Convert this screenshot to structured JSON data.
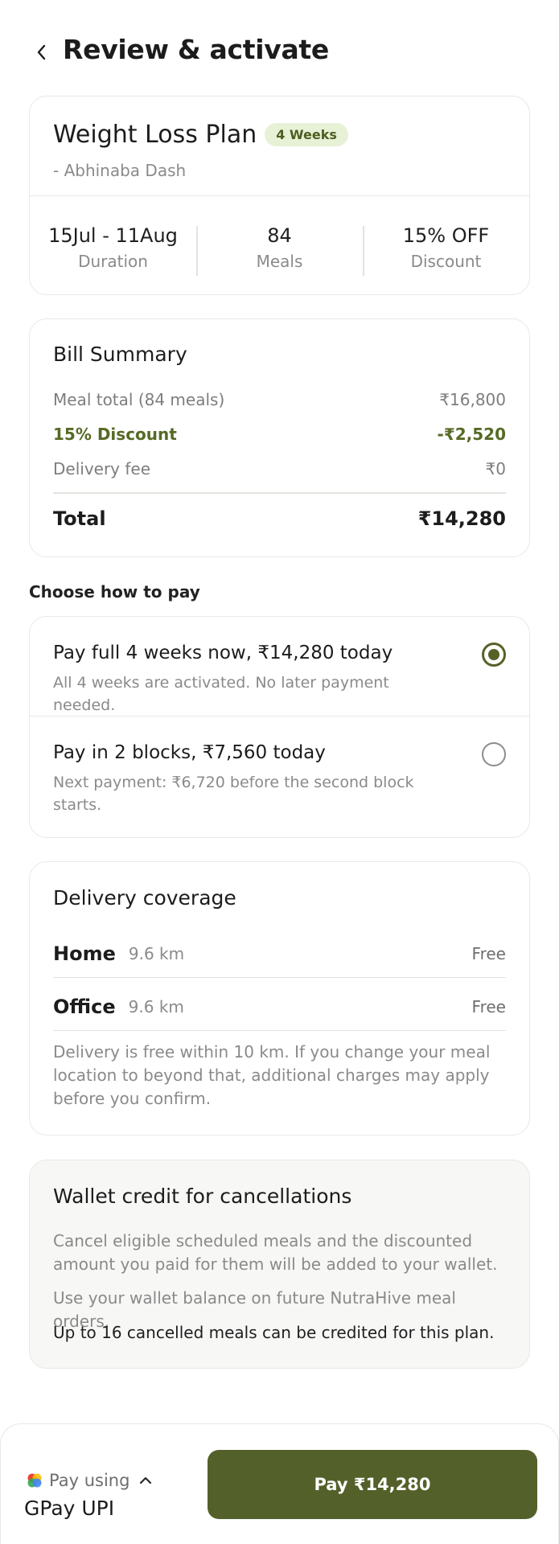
{
  "header": {
    "title": "Review & activate",
    "back_icon": "chevron-left-icon"
  },
  "plan": {
    "name": "Weight Loss Plan",
    "badge": "4 Weeks",
    "owner": "- Abhinaba Dash",
    "stats": [
      {
        "value": "15Jul - 11Aug",
        "label": "Duration"
      },
      {
        "value": "84",
        "label": "Meals"
      },
      {
        "value": "15% OFF",
        "label": "Discount"
      }
    ]
  },
  "bill": {
    "title": "Bill Summary",
    "rows": [
      {
        "label": "Meal total (84 meals)",
        "value": "₹16,800"
      },
      {
        "label": "15% Discount",
        "value": "-₹2,520"
      },
      {
        "label": "Delivery fee",
        "value": "₹0"
      }
    ],
    "total": {
      "label": "Total",
      "value": "₹14,280"
    }
  },
  "payment": {
    "heading": "Choose how to pay",
    "options": [
      {
        "title": "Pay full 4 weeks now, ₹14,280 today",
        "subtitle": "All 4 weeks are activated. No later payment needed.",
        "selected": true
      },
      {
        "title": "Pay in 2 blocks, ₹7,560 today",
        "subtitle": "Next payment: ₹6,720 before the second block starts.",
        "selected": false
      }
    ]
  },
  "delivery": {
    "title": "Delivery coverage",
    "locations": [
      {
        "name": "Home",
        "distance": "9.6 km",
        "fee": "Free"
      },
      {
        "name": "Office",
        "distance": "9.6 km",
        "fee": "Free"
      }
    ],
    "note": "Delivery is free within 10 km. If you change your meal location to beyond that, additional charges may apply before you confirm."
  },
  "wallet": {
    "title": "Wallet credit for cancellations",
    "para1": "Cancel eligible scheduled meals and the discounted amount you paid for them will be added to your wallet.",
    "para2": "Use your wallet balance on future NutraHive meal orders.",
    "para3": "Up to 16 cancelled meals can be credited for this plan."
  },
  "footer": {
    "pay_using_label": "Pay using",
    "method": "GPay UPI",
    "pay_button": "Pay ₹14,280",
    "accent_color": "#546029"
  }
}
